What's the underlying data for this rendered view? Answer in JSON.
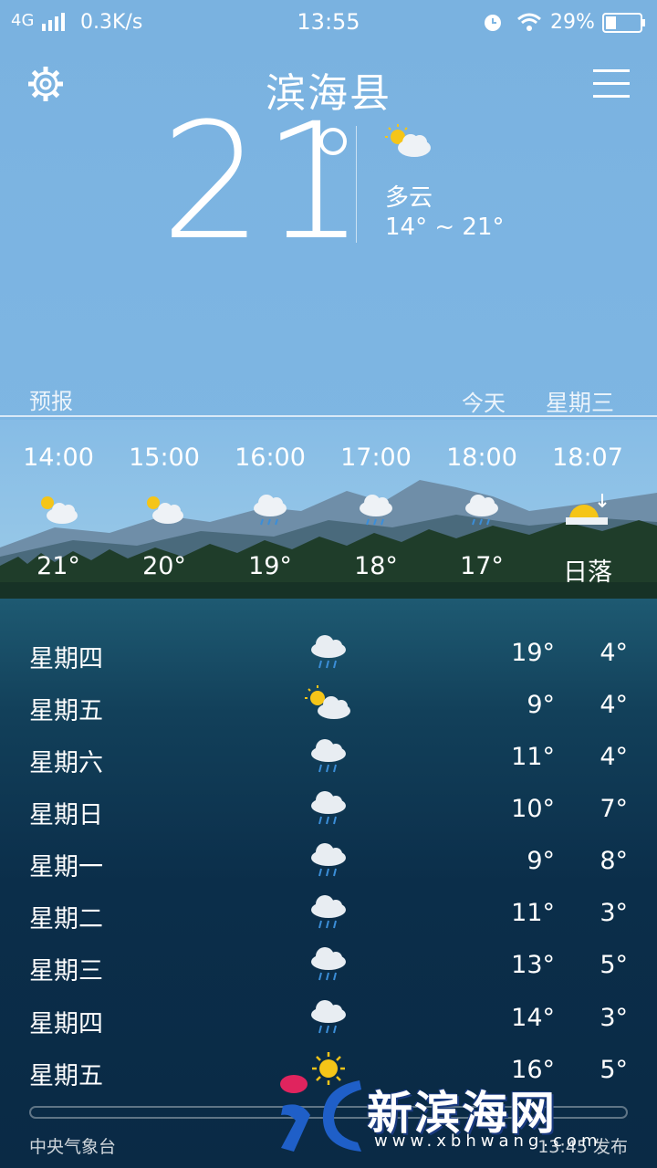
{
  "status": {
    "network": "4G",
    "speed": "0.3K/s",
    "time": "13:55",
    "battery": "29%",
    "icons": [
      "signal-icon",
      "alarm-icon",
      "wifi-icon",
      "battery-icon"
    ]
  },
  "header": {
    "city": "滨海县",
    "icons": [
      "gear-icon",
      "menu-icon"
    ]
  },
  "current": {
    "temp": "21",
    "condition": "多云",
    "range": "14° ~ 21°",
    "icon": "partly-cloudy-icon"
  },
  "forecast_header": {
    "label": "预报",
    "today": "今天",
    "weekday": "星期三"
  },
  "hourly": [
    {
      "time": "14:00",
      "icon": "partly-cloudy-icon",
      "temp": "21°"
    },
    {
      "time": "15:00",
      "icon": "partly-cloudy-icon",
      "temp": "20°"
    },
    {
      "time": "16:00",
      "icon": "light-rain-icon",
      "temp": "19°"
    },
    {
      "time": "17:00",
      "icon": "light-rain-icon",
      "temp": "18°"
    },
    {
      "time": "18:00",
      "icon": "light-rain-icon",
      "temp": "17°"
    },
    {
      "time": "18:07",
      "icon": "sunset-icon",
      "temp": "日落"
    }
  ],
  "daily": [
    {
      "day": "星期四",
      "icon": "rain-icon",
      "hi": "19°",
      "lo": "4°"
    },
    {
      "day": "星期五",
      "icon": "partly-cloudy-icon",
      "hi": "9°",
      "lo": "4°"
    },
    {
      "day": "星期六",
      "icon": "rain-icon",
      "hi": "11°",
      "lo": "4°"
    },
    {
      "day": "星期日",
      "icon": "rain-icon",
      "hi": "10°",
      "lo": "7°"
    },
    {
      "day": "星期一",
      "icon": "rain-icon",
      "hi": "9°",
      "lo": "8°"
    },
    {
      "day": "星期二",
      "icon": "rain-icon",
      "hi": "11°",
      "lo": "3°"
    },
    {
      "day": "星期三",
      "icon": "rain-icon",
      "hi": "13°",
      "lo": "5°"
    },
    {
      "day": "星期四",
      "icon": "rain-icon",
      "hi": "14°",
      "lo": "3°"
    },
    {
      "day": "星期五",
      "icon": "sunny-icon",
      "hi": "16°",
      "lo": "5°"
    }
  ],
  "footer": {
    "source": "中央气象台",
    "publish": "13:45 发布"
  },
  "watermark": {
    "name": "新滨海网",
    "url": "www.xbhwang.com"
  },
  "colors": {
    "sky": "#7eb6e3",
    "panel": "#0b2e4a",
    "sun": "#f5c518",
    "cloud": "#e8edf2"
  }
}
